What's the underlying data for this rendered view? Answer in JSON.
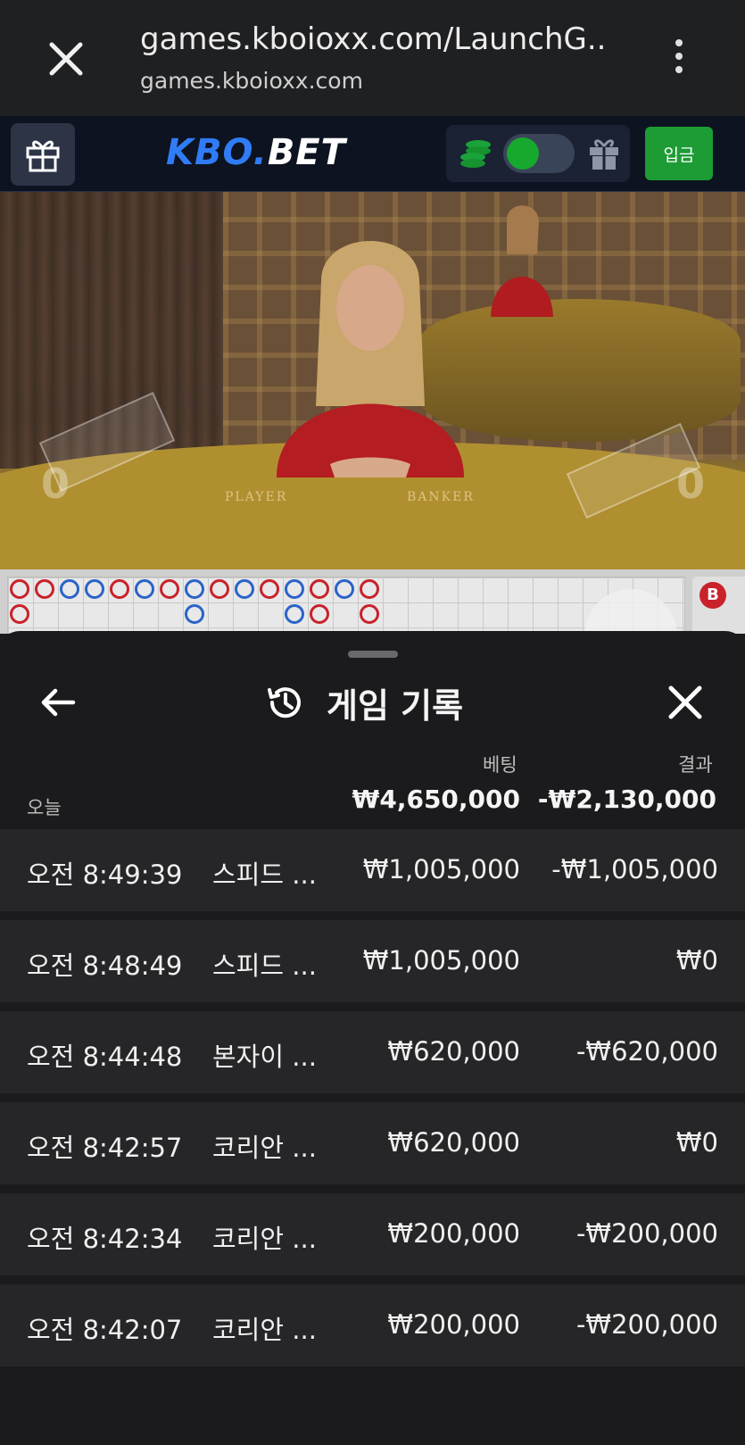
{
  "browser": {
    "title": "games.kboioxx.com/LaunchG...",
    "url": "games.kboioxx.com"
  },
  "site": {
    "logo_part1": "KBO.",
    "logo_part2": "BET",
    "deposit_label": "입금",
    "accent_green": "#1d9b34",
    "accent_blue": "#2f7cf6"
  },
  "video": {
    "label_player": "PLAYER",
    "label_banker": "BANKER",
    "score_left": "0",
    "score_right": "0"
  },
  "roadmap": {
    "side_chip": "B"
  },
  "history": {
    "title": "게임 기록",
    "col_bet": "베팅",
    "col_result": "결과",
    "today_label": "오늘",
    "total_bet": "₩4,650,000",
    "total_result": "-₩2,130,000",
    "rows": [
      {
        "time": "오전 8:49:39",
        "game": "스피드 ...",
        "bet": "₩1,005,000",
        "result": "-₩1,005,000"
      },
      {
        "time": "오전 8:48:49",
        "game": "스피드 ...",
        "bet": "₩1,005,000",
        "result": "₩0"
      },
      {
        "time": "오전 8:44:48",
        "game": "본자이 ...",
        "bet": "₩620,000",
        "result": "-₩620,000"
      },
      {
        "time": "오전 8:42:57",
        "game": "코리안 ...",
        "bet": "₩620,000",
        "result": "₩0"
      },
      {
        "time": "오전 8:42:34",
        "game": "코리안 ...",
        "bet": "₩200,000",
        "result": "-₩200,000"
      },
      {
        "time": "오전 8:42:07",
        "game": "코리안 ...",
        "bet": "₩200,000",
        "result": "-₩200,000"
      }
    ]
  }
}
